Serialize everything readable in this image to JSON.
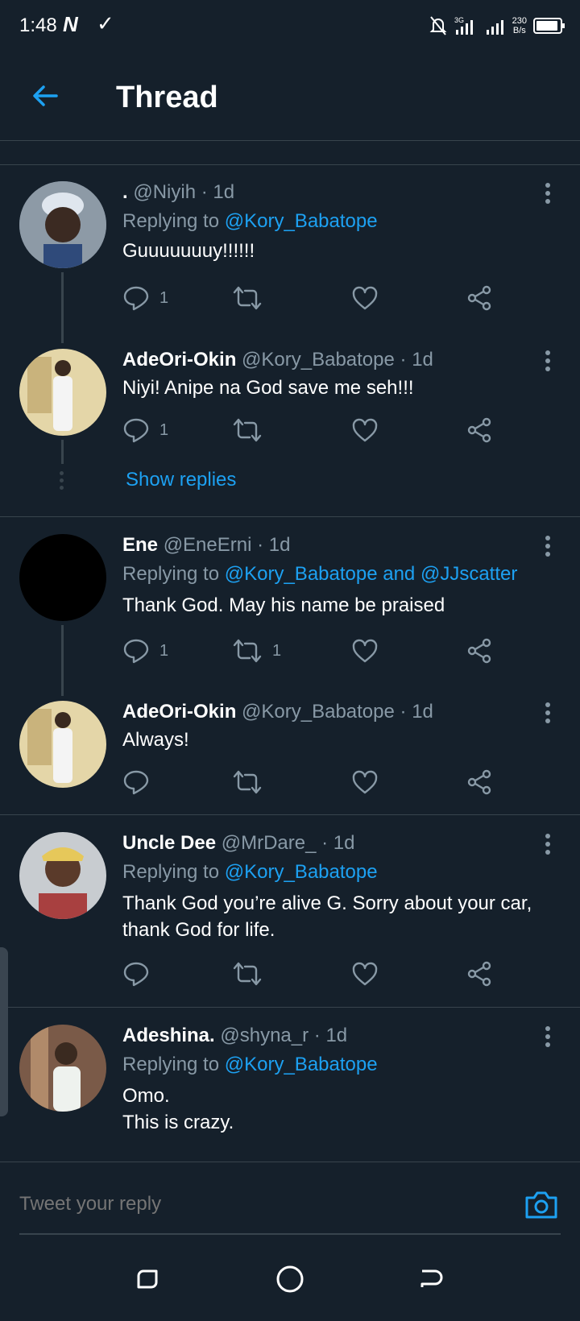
{
  "status": {
    "time": "1:48",
    "n_glyph": "N",
    "speed_value": "230",
    "speed_unit": "B/s",
    "network": "3G"
  },
  "header": {
    "title": "Thread"
  },
  "tweets": [
    {
      "name": ".",
      "handle": "@Niyih",
      "time": "· 1d",
      "replying_prefix": "Replying to",
      "replying_to": "@Kory_Babatope",
      "text": "Guuuuuuuy!!!!!!",
      "reply_count": "1",
      "retweet_count": "",
      "avatar_color": "#6b7a8c"
    },
    {
      "name": "AdeOri-Okin",
      "handle": "@Kory_Babatope",
      "time": "· 1d",
      "text": "Niyi! Anipe na God save me seh!!!",
      "reply_count": "1",
      "retweet_count": "",
      "avatar_color": "#d8c89a"
    },
    {
      "name": "Ene",
      "handle": "@EneErni",
      "time": "· 1d",
      "replying_prefix": "Replying to",
      "replying_to": "@Kory_Babatope and @JJscatter",
      "text": "Thank God. May his name be praised",
      "reply_count": "1",
      "retweet_count": "1",
      "avatar_color": "#000000"
    },
    {
      "name": "AdeOri-Okin",
      "handle": "@Kory_Babatope",
      "time": "· 1d",
      "text": "Always!",
      "reply_count": "",
      "retweet_count": "",
      "avatar_color": "#d8c89a"
    },
    {
      "name": "Uncle Dee",
      "handle": "@MrDare_",
      "time": "· 1d",
      "replying_prefix": "Replying to",
      "replying_to": "@Kory_Babatope",
      "text": "Thank God you’re alive G. Sorry about your car, thank God for life.",
      "reply_count": "",
      "retweet_count": "",
      "avatar_color": "#a84040"
    },
    {
      "name": "Adeshina.",
      "handle": "@shyna_r",
      "time": "· 1d",
      "replying_prefix": "Replying to",
      "replying_to": "@Kory_Babatope",
      "text_line1": "Omo.",
      "text_line2": "This is crazy.",
      "avatar_color": "#6b5a50"
    }
  ],
  "show_replies": "Show replies",
  "reply_bar": {
    "placeholder": "Tweet your reply"
  },
  "colors": {
    "background": "#15202b",
    "accent": "#1da1f2",
    "muted": "#8899a6",
    "divider": "#38444d"
  }
}
